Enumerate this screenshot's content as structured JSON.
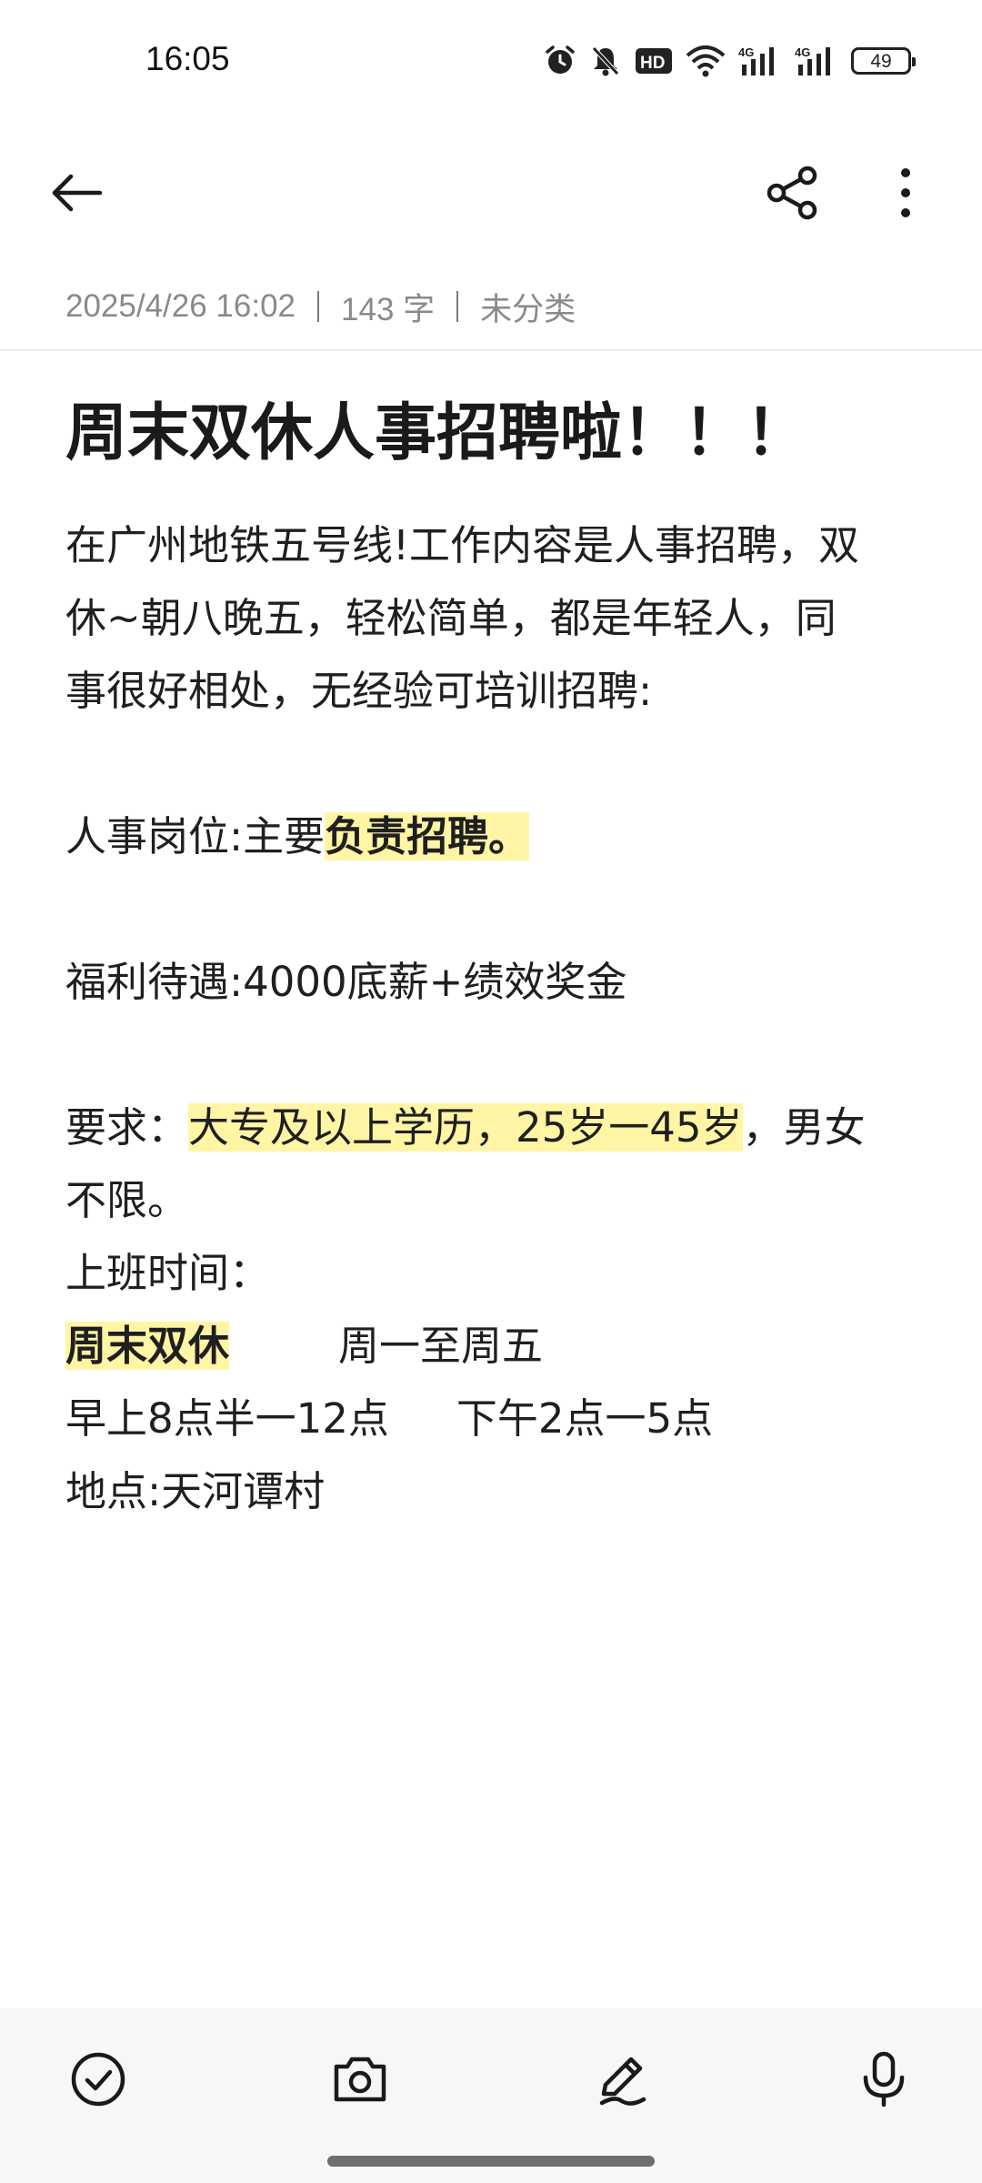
{
  "status_bar": {
    "time": "16:05",
    "battery": "49",
    "network_1": "4G",
    "network_2": "4G",
    "hd_label": "HD",
    "icons": [
      "alarm-icon",
      "mute-icon",
      "hd-icon",
      "wifi-icon",
      "signal-icon",
      "signal-icon",
      "battery-icon"
    ]
  },
  "toolbar": {
    "back_icon": "arrow-left-icon",
    "share_icon": "share-icon",
    "more_icon": "more-vertical-icon"
  },
  "meta": {
    "date": "2025/4/26 16:02",
    "word_count": "143 字",
    "category": "未分类"
  },
  "note": {
    "title": "周末双休人事招聘啦！！！",
    "para1_line1": "在广州地铁五号线!工作内容是人事招聘，双",
    "para1_line2": "休~朝八晚五，轻松简单，都是年轻人，同",
    "para1_line3": "事很好相处，无经验可培训招聘:",
    "position_prefix": "人事岗位:主要",
    "position_highlight": "负责招聘。",
    "welfare": "福利待遇:4000底薪+绩效奖金",
    "req_prefix": "要求：",
    "req_highlight": "大专及以上学历，25岁一45岁",
    "req_suffix": "，男女",
    "req_line2": "不限。",
    "hours_label": "上班时间：",
    "hours_weekend": "周末双休",
    "hours_weekdays": "周一至周五",
    "hours_morning": "早上8点半一12点",
    "hours_afternoon": "下午2点一5点",
    "location": "地点:天河谭村"
  },
  "bottom_toolbar": {
    "checklist_icon": "check-circle-icon",
    "camera_icon": "camera-icon",
    "pen_icon": "pen-icon",
    "mic_icon": "microphone-icon"
  },
  "colors": {
    "highlight": "#fff5a5",
    "meta_text": "#8a8a8a",
    "bottom_bar": "#f7f7f7"
  }
}
